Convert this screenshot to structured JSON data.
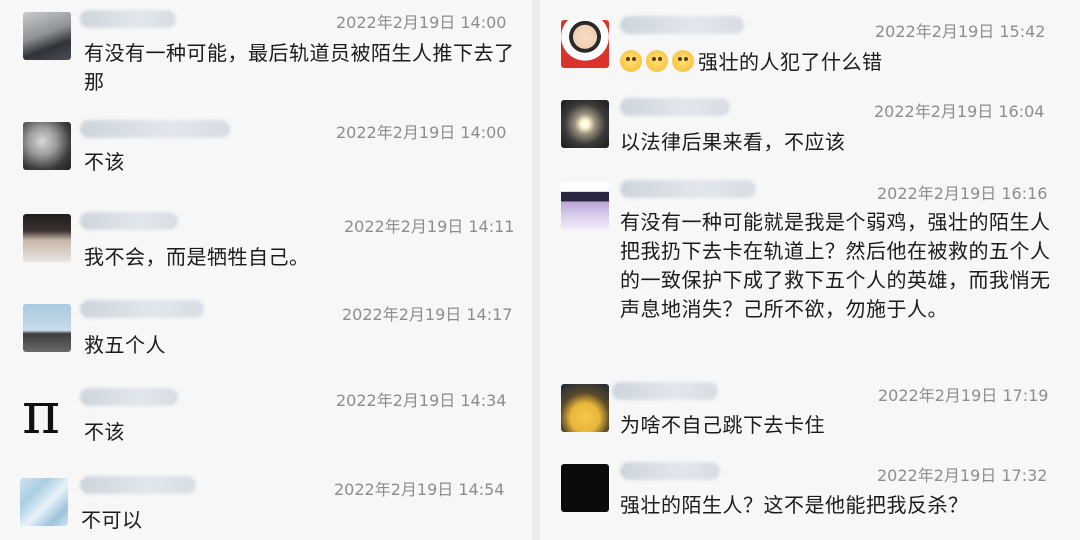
{
  "left_column": {
    "messages": [
      {
        "time": "2022年2月19日 14:00",
        "text": "有没有一种可能，最后轨道员被陌生人推下去了那",
        "avatar": "man-dark-jacket-avatar"
      },
      {
        "time": "2022年2月19日 14:00",
        "text": "不该",
        "avatar": "cartoon-character-avatar"
      },
      {
        "time": "2022年2月19日 14:11",
        "text": "我不会，而是牺牲自己。",
        "avatar": "young-man-avatar"
      },
      {
        "time": "2022年2月19日 14:17",
        "text": "救五个人",
        "avatar": "sky-landscape-avatar"
      },
      {
        "time": "2022年2月19日 14:34",
        "text": "不该",
        "avatar": "pi-symbol-avatar",
        "avatar_glyph": "π"
      },
      {
        "time": "2022年2月19日 14:54",
        "text": "不可以",
        "avatar": "blue-water-avatar"
      }
    ]
  },
  "right_column": {
    "messages": [
      {
        "time": "2022年2月19日 15:42",
        "text": "强壮的人犯了什么错",
        "avatar": "cartoon-boy-avatar",
        "emoji": "hot-face-emoji",
        "emoji_count": 3
      },
      {
        "time": "2022年2月19日 16:04",
        "text": "以法律后果来看，不应该",
        "avatar": "sparkler-avatar"
      },
      {
        "time": "2022年2月19日 16:16",
        "text": "有没有一种可能就是我是个弱鸡，强壮的陌生人把我扔下去卡在轨道上？然后他在被救的五个人的一致保护下成了救下五个人的英雄，而我悄无声息地消失？己所不欲，勿施于人。",
        "avatar": "witch-girl-avatar"
      },
      {
        "time": "2022年2月19日 17:19",
        "text": "为啥不自己跳下去卡住",
        "avatar": "pikachu-avatar"
      },
      {
        "time": "2022年2月19日 17:32",
        "text": "强壮的陌生人？这不是他能把我反杀？",
        "avatar": "black-avatar"
      }
    ]
  },
  "colors": {
    "background": "#f7f7f7",
    "divider": "#ececec",
    "time_text": "#8d8d8d",
    "message_text": "#1b1b1b"
  }
}
